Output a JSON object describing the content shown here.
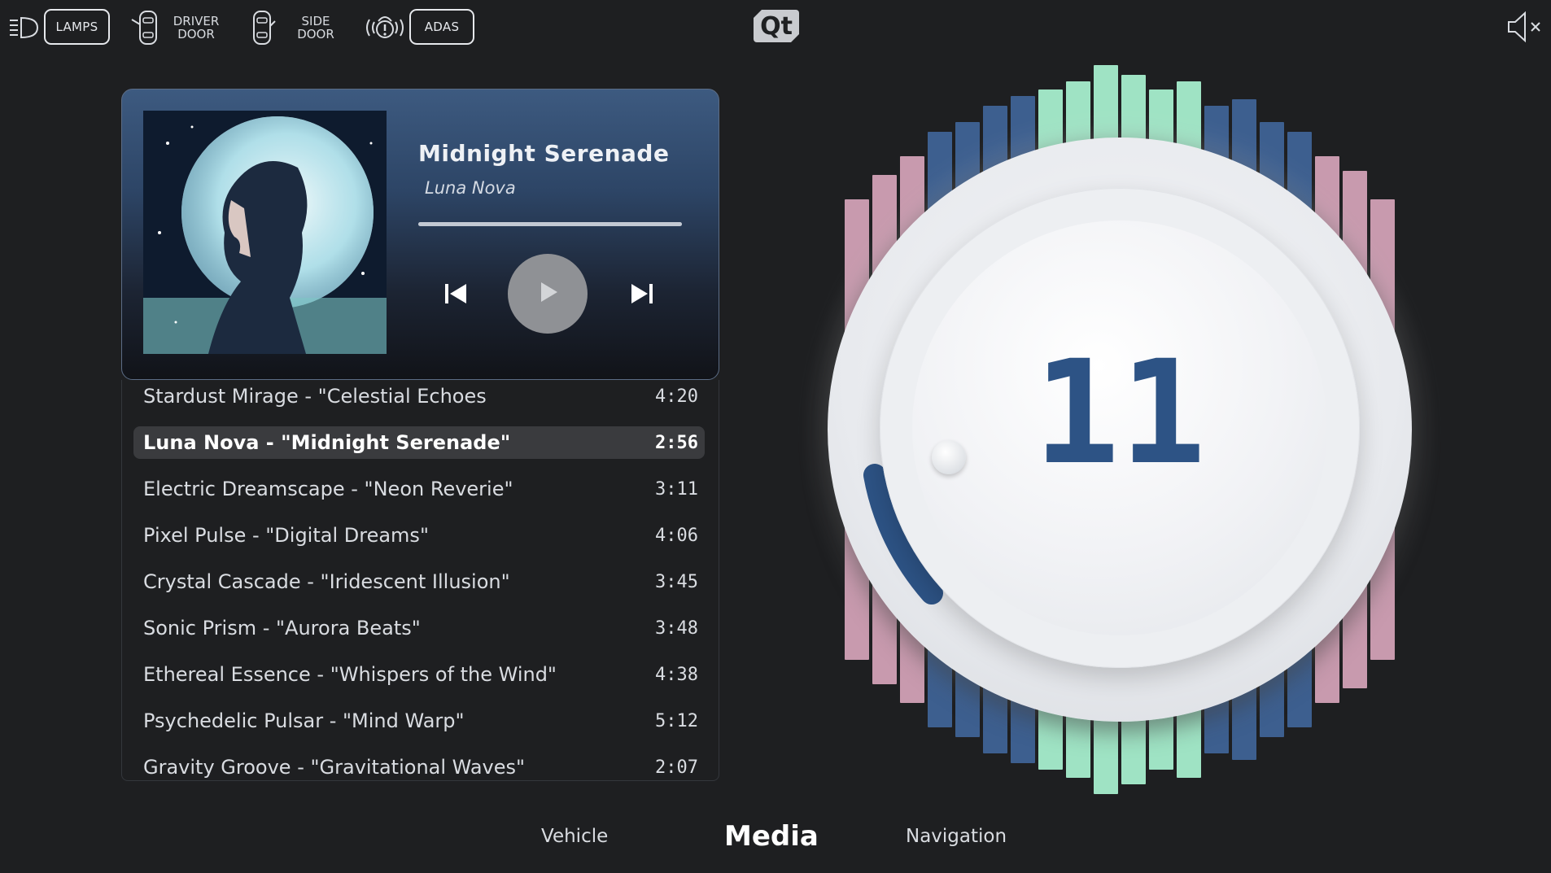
{
  "topbar": {
    "lamps_label": "LAMPS",
    "driver_door_label_1": "DRIVER",
    "driver_door_label_2": "DOOR",
    "side_door_label_1": "SIDE",
    "side_door_label_2": "DOOR",
    "adas_label": "ADAS",
    "logo_text": "Qt"
  },
  "player": {
    "title": "Midnight Serenade",
    "artist": "Luna Nova",
    "progress_fraction": 1.0
  },
  "playlist": [
    {
      "name": "Stardust Mirage - \"Celestial Echoes",
      "duration": "4:20",
      "active": false
    },
    {
      "name": "Luna Nova - \"Midnight Serenade\"",
      "duration": "2:56",
      "active": true
    },
    {
      "name": "Electric Dreamscape - \"Neon Reverie\"",
      "duration": "3:11",
      "active": false
    },
    {
      "name": "Pixel Pulse - \"Digital Dreams\"",
      "duration": "4:06",
      "active": false
    },
    {
      "name": "Crystal Cascade - \"Iridescent Illusion\"",
      "duration": "3:45",
      "active": false
    },
    {
      "name": "Sonic Prism - \"Aurora Beats\"",
      "duration": "3:48",
      "active": false
    },
    {
      "name": "Ethereal Essence - \"Whispers of the Wind\"",
      "duration": "4:38",
      "active": false
    },
    {
      "name": "Psychedelic Pulsar - \"Mind Warp\"",
      "duration": "5:12",
      "active": false
    },
    {
      "name": "Gravity Groove - \"Gravitational Waves\"",
      "duration": "2:07",
      "active": false
    }
  ],
  "volume": {
    "value": "11",
    "muted_icon": "speaker-muted-icon"
  },
  "nav": {
    "vehicle": "Vehicle",
    "media": "Media",
    "navigation": "Navigation",
    "active": "Media"
  },
  "colors": {
    "background": "#1e1f21",
    "accent_blue": "#2d5385",
    "bar_blue": "#3d5f8f",
    "bar_mint": "#9fe3c4",
    "bar_pink": "#c89aae"
  }
}
